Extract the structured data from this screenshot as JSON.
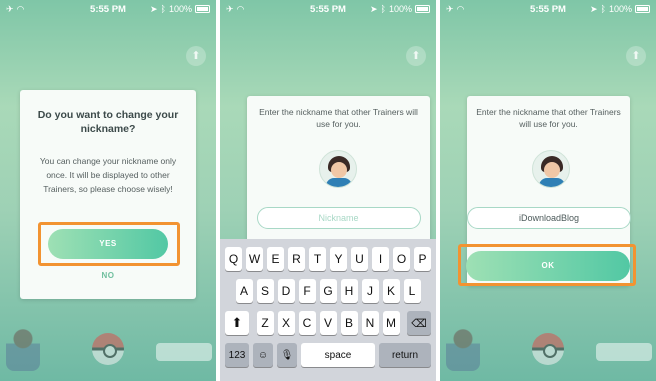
{
  "screens": [
    {
      "status": {
        "time": "5:55 PM",
        "battery": "100%"
      },
      "dialog": {
        "title": "Do you want to change your nickname?",
        "body": "You can change your nickname only once. It will be displayed to other Trainers, so please choose wisely!",
        "yes_label": "YES",
        "no_label": "NO"
      }
    },
    {
      "status": {
        "time": "5:55 PM",
        "battery": "100%"
      },
      "dialog": {
        "prompt": "Enter the nickname that other Trainers will use for you.",
        "input_placeholder": "Nickname",
        "input_value": ""
      },
      "keyboard": {
        "row1": [
          "Q",
          "W",
          "E",
          "R",
          "T",
          "Y",
          "U",
          "I",
          "O",
          "P"
        ],
        "row2": [
          "A",
          "S",
          "D",
          "F",
          "G",
          "H",
          "J",
          "K",
          "L"
        ],
        "row3": [
          "Z",
          "X",
          "C",
          "V",
          "B",
          "N",
          "M"
        ],
        "numbers_label": "123",
        "space_label": "space",
        "return_label": "return"
      }
    },
    {
      "status": {
        "time": "5:55 PM",
        "battery": "100%"
      },
      "dialog": {
        "prompt": "Enter the nickname that other Trainers will use for you.",
        "input_value": "iDownloadBlog",
        "ok_label": "OK"
      }
    }
  ],
  "colors": {
    "highlight": "#f29331",
    "button_gradient_start": "#9ee0b4",
    "button_gradient_end": "#52c8a4",
    "background_top": "#7fc6a7"
  }
}
